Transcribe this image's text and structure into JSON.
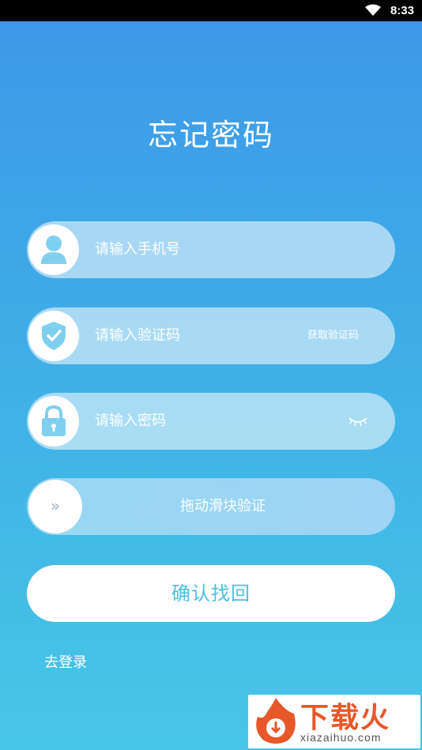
{
  "status_bar": {
    "time": "8:33",
    "wifi_icon": "wifi-icon"
  },
  "page": {
    "title": "忘记密码"
  },
  "form": {
    "phone_placeholder": "请输入手机号",
    "code_placeholder": "请输入验证码",
    "get_code_label": "获取验证码",
    "password_placeholder": "请输入密码",
    "slider_label": "拖动滑块验证",
    "slider_knob": "»",
    "confirm_label": "确认找回",
    "login_link": "去登录"
  },
  "watermark": {
    "text": "下载火",
    "domain": "xiazaihuo.com"
  },
  "colors": {
    "accent": "#4cc0e0",
    "bg_top": "#3d97e9",
    "bg_bottom": "#48c6e7",
    "icon": "#7fd0ee"
  }
}
